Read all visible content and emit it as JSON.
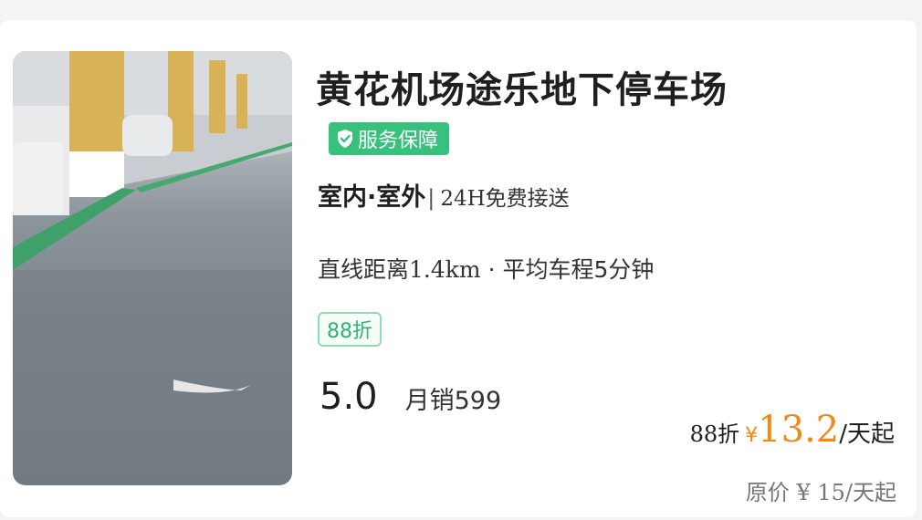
{
  "listing": {
    "title": "黄花机场途乐地下停车场",
    "badge": {
      "icon": "shield-check-icon",
      "label": "服务保障"
    },
    "location": {
      "type": "室内·室外",
      "separator": "|",
      "service": "24H免费接送"
    },
    "distance": {
      "prefix": "直线距离",
      "value": "1.4km",
      "separator": "·",
      "drive": "平均车程5分钟"
    },
    "discount_tag": "88折",
    "rating": "5.0",
    "monthly_sales": "月销599",
    "price": {
      "prefix": "88折",
      "currency": "¥",
      "value": "13.2",
      "unit": "/天起"
    },
    "original_price": "原价 ¥ 15/天起"
  },
  "colors": {
    "accent_green": "#38c07d",
    "price_orange": "#f08a14",
    "tag_border": "#8fdcb6"
  }
}
